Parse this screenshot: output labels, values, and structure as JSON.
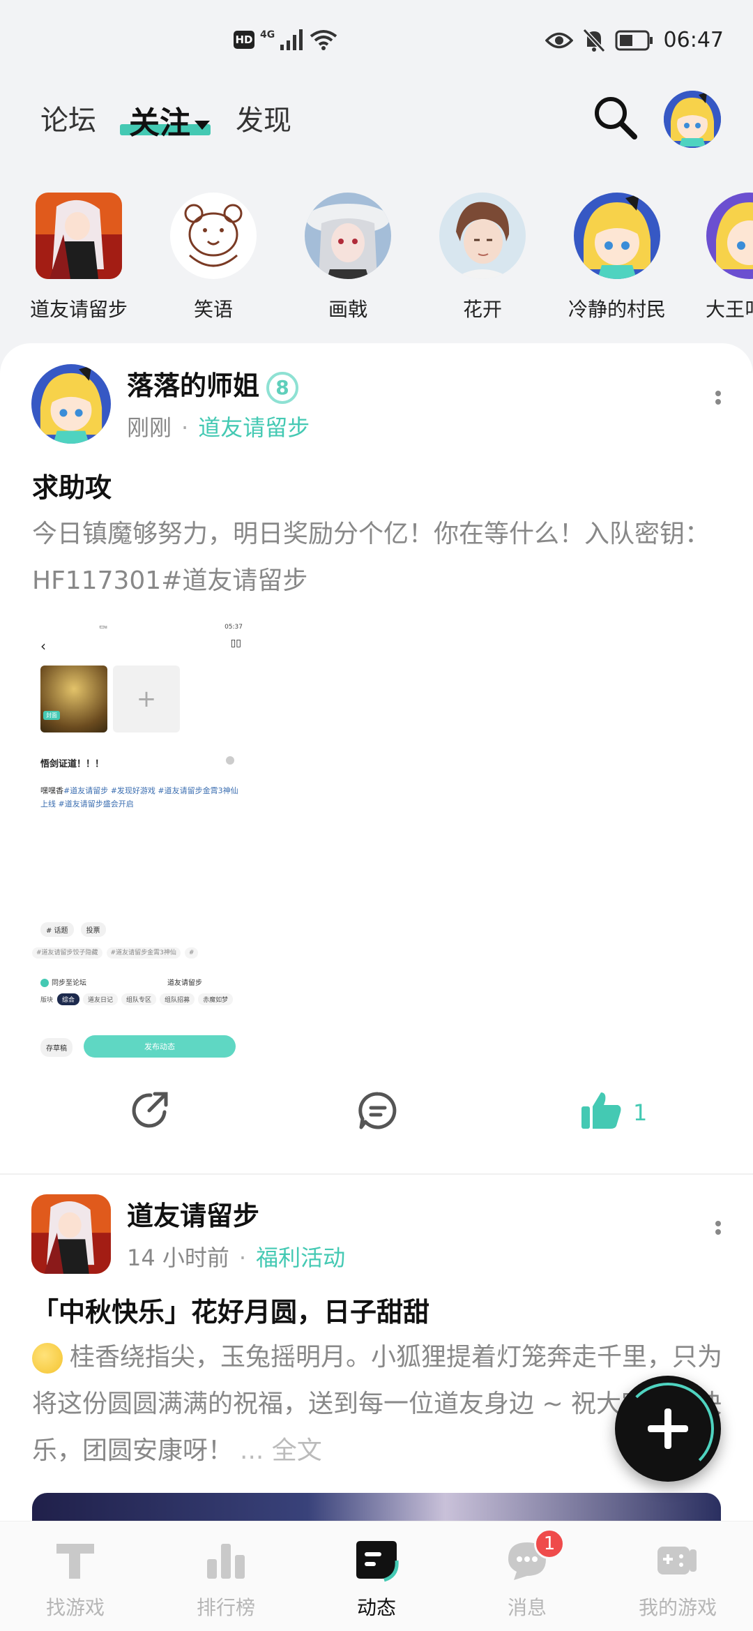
{
  "status_bar": {
    "hd": "HD",
    "network": "4G",
    "time": "06:47"
  },
  "header": {
    "tabs": [
      {
        "label": "论坛"
      },
      {
        "label": "关注"
      },
      {
        "label": "发现"
      }
    ],
    "active_tab": "关注",
    "accent_color": "#44c9b3"
  },
  "following": [
    {
      "name": "道友请留步",
      "icon": "game-app-avatar"
    },
    {
      "name": "笑语",
      "icon": "bear-sketch-avatar"
    },
    {
      "name": "画戟",
      "icon": "anime-girl-hat-avatar"
    },
    {
      "name": "花开",
      "icon": "anime-boy-avatar"
    },
    {
      "name": "冷静的村民",
      "icon": "yellow-hair-avatar"
    },
    {
      "name": "大王叫",
      "icon": "yellow-hair-avatar"
    }
  ],
  "posts": [
    {
      "author": "落落的师姐",
      "level": "8",
      "time": "刚刚",
      "tag": "道友请留步",
      "title": "求助攻",
      "body": "今日镇魔够努力，明日奖励分个亿！你在等什么！入队密钥：HF117301#道友请留步",
      "like_count": "1",
      "screenshot": {
        "time": "05:37",
        "badge": "封面",
        "title": "悟剑证道！！！",
        "text_prefix": "嘿嘿香",
        "text_tags": "#道友请留步 #发现好游戏 #道友请留步金霄3神仙上线 #道友请留步盛会开启",
        "chips": [
          "# 话题",
          "投票"
        ],
        "tags": [
          "#道友请留步饺子隐藏",
          "#道友请留步金霄3神仙",
          "#"
        ],
        "sync_label": "同步至论坛",
        "sync_game": "道友请留步",
        "board_label": "版块",
        "boards": [
          "综合",
          "道友日记",
          "组队专区",
          "组队招募",
          "赤魔如梦"
        ],
        "save_label": "存草稿",
        "publish_label": "发布动态"
      }
    },
    {
      "author": "道友请留步",
      "time": "14 小时前",
      "tag": "福利活动",
      "title": "「中秋快乐」花好月圆，日子甜甜",
      "body": "桂香绕指尖，玉兔摇明月。小狐狸提着灯笼奔走千里，只为将这份圆圆满满的祝福，送到每一位道友身边 ~ 祝大家中秋快乐，团圆安康呀！",
      "more": "... 全文"
    }
  ],
  "bottom_nav": [
    {
      "label": "找游戏",
      "icon": "find-game-icon"
    },
    {
      "label": "排行榜",
      "icon": "ranking-icon"
    },
    {
      "label": "动态",
      "icon": "feed-icon"
    },
    {
      "label": "消息",
      "icon": "message-icon",
      "badge": "1"
    },
    {
      "label": "我的游戏",
      "icon": "my-games-icon"
    }
  ],
  "active_nav": "动态"
}
